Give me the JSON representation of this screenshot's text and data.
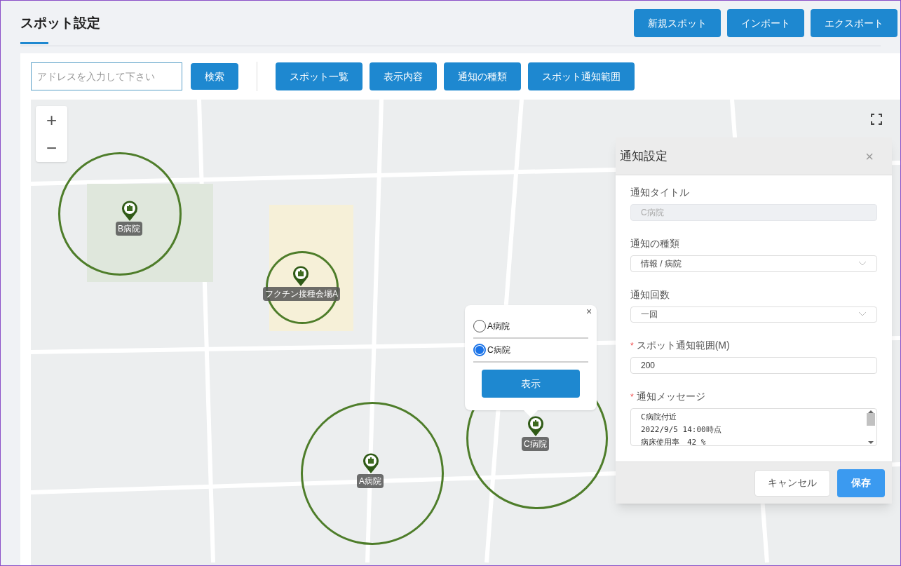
{
  "page": {
    "title": "スポット設定"
  },
  "header_buttons": [
    "新規スポット",
    "インポート",
    "エクスポート"
  ],
  "search": {
    "placeholder": "アドレスを入力して下さい",
    "button": "検索"
  },
  "toolbar_buttons": [
    "スポット一覧",
    "表示内容",
    "通知の種類",
    "スポット通知範囲"
  ],
  "map": {
    "zoom_in": "+",
    "zoom_out": "−",
    "spots": [
      {
        "label": "B病院"
      },
      {
        "label": "フクチン接種会場A"
      },
      {
        "label": "C病院"
      },
      {
        "label": "A病院"
      }
    ]
  },
  "popup": {
    "close": "×",
    "options": [
      {
        "label": "A病院",
        "selected": false
      },
      {
        "label": "C病院",
        "selected": true
      }
    ],
    "button": "表示"
  },
  "dialog": {
    "title": "通知設定",
    "close": "×",
    "required_mark": "*",
    "fields": [
      {
        "kind": "readonly",
        "label": "通知タイトル",
        "required": false,
        "value": "C病院"
      },
      {
        "kind": "select",
        "label": "通知の種類",
        "required": false,
        "value": "情報 / 病院"
      },
      {
        "kind": "select",
        "label": "通知回数",
        "required": false,
        "value": "一回"
      },
      {
        "kind": "text",
        "label": "スポット通知範囲(M)",
        "required": true,
        "value": "200"
      },
      {
        "kind": "textarea",
        "label": "通知メッセージ",
        "required": true,
        "lines": [
          "C病院付近",
          "2022/9/5 14:00時点",
          "病床使用率　42 %"
        ]
      }
    ],
    "cancel": "キャンセル",
    "save": "保存"
  }
}
